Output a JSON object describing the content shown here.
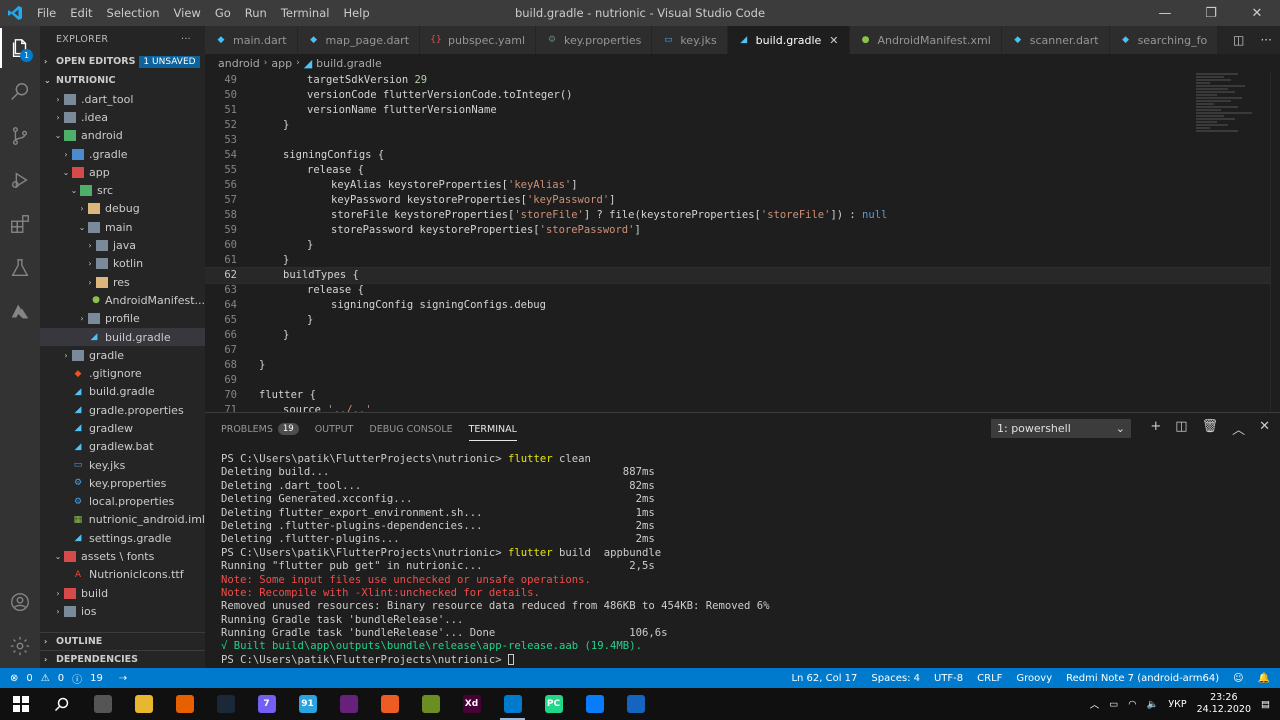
{
  "window": {
    "title": "build.gradle - nutrionic - Visual Studio Code",
    "menu": [
      "File",
      "Edit",
      "Selection",
      "View",
      "Go",
      "Run",
      "Terminal",
      "Help"
    ]
  },
  "activity": {
    "explorer_badge": "1"
  },
  "sidebar": {
    "header": "EXPLORER",
    "open_editors": "OPEN EDITORS",
    "unsaved": "1 UNSAVED",
    "project": "NUTRIONIC",
    "tree": [
      {
        "label": ".dart_tool",
        "depth": 1,
        "chev": "›",
        "icon": "folder"
      },
      {
        "label": ".idea",
        "depth": 1,
        "chev": "›",
        "icon": "folder"
      },
      {
        "label": "android",
        "depth": 1,
        "chev": "⌄",
        "icon": "folder-green"
      },
      {
        "label": ".gradle",
        "depth": 2,
        "chev": "›",
        "icon": "folder-blue"
      },
      {
        "label": "app",
        "depth": 2,
        "chev": "⌄",
        "icon": "folder-red"
      },
      {
        "label": "src",
        "depth": 3,
        "chev": "⌄",
        "icon": "folder-green"
      },
      {
        "label": "debug",
        "depth": 4,
        "chev": "›",
        "icon": "folder-yellow"
      },
      {
        "label": "main",
        "depth": 4,
        "chev": "⌄",
        "icon": "folder"
      },
      {
        "label": "java",
        "depth": 5,
        "chev": "›",
        "icon": "folder"
      },
      {
        "label": "kotlin",
        "depth": 5,
        "chev": "›",
        "icon": "folder"
      },
      {
        "label": "res",
        "depth": 5,
        "chev": "›",
        "icon": "folder-yellow"
      },
      {
        "label": "AndroidManifest...",
        "depth": 5,
        "chev": "",
        "icon": "android"
      },
      {
        "label": "profile",
        "depth": 4,
        "chev": "›",
        "icon": "folder"
      },
      {
        "label": "build.gradle",
        "depth": 4,
        "chev": "",
        "icon": "gradle",
        "selected": true
      },
      {
        "label": "gradle",
        "depth": 2,
        "chev": "›",
        "icon": "folder"
      },
      {
        "label": ".gitignore",
        "depth": 2,
        "chev": "",
        "icon": "git"
      },
      {
        "label": "build.gradle",
        "depth": 2,
        "chev": "",
        "icon": "gradle"
      },
      {
        "label": "gradle.properties",
        "depth": 2,
        "chev": "",
        "icon": "gradle"
      },
      {
        "label": "gradlew",
        "depth": 2,
        "chev": "",
        "icon": "gradle"
      },
      {
        "label": "gradlew.bat",
        "depth": 2,
        "chev": "",
        "icon": "gradle"
      },
      {
        "label": "key.jks",
        "depth": 2,
        "chev": "",
        "icon": "file"
      },
      {
        "label": "key.properties",
        "depth": 2,
        "chev": "",
        "icon": "gear"
      },
      {
        "label": "local.properties",
        "depth": 2,
        "chev": "",
        "icon": "gear"
      },
      {
        "label": "nutrionic_android.iml",
        "depth": 2,
        "chev": "",
        "icon": "iml"
      },
      {
        "label": "settings.gradle",
        "depth": 2,
        "chev": "",
        "icon": "gradle"
      },
      {
        "label": "assets \\ fonts",
        "depth": 1,
        "chev": "⌄",
        "icon": "folder-red"
      },
      {
        "label": "NutrionicIcons.ttf",
        "depth": 2,
        "chev": "",
        "icon": "font"
      },
      {
        "label": "build",
        "depth": 1,
        "chev": "›",
        "icon": "folder-red"
      },
      {
        "label": "ios",
        "depth": 1,
        "chev": "›",
        "icon": "folder"
      }
    ],
    "outline": "OUTLINE",
    "dependencies": "DEPENDENCIES"
  },
  "tabs": [
    {
      "label": "main.dart",
      "icon": "dart",
      "color": "#40c4ff"
    },
    {
      "label": "map_page.dart",
      "icon": "dart",
      "color": "#40c4ff"
    },
    {
      "label": "pubspec.yaml",
      "icon": "yaml",
      "color": "#f14c4c"
    },
    {
      "label": "key.properties",
      "icon": "gear",
      "color": "#6d8086"
    },
    {
      "label": "key.jks",
      "icon": "file",
      "color": "#42a5f5"
    },
    {
      "label": "build.gradle",
      "icon": "gradle",
      "color": "#4fc3f7",
      "active": true
    },
    {
      "label": "AndroidManifest.xml",
      "icon": "android",
      "color": "#8bc34a"
    },
    {
      "label": "scanner.dart",
      "icon": "dart",
      "color": "#40c4ff"
    },
    {
      "label": "searching_fo",
      "icon": "dart",
      "color": "#40c4ff"
    }
  ],
  "breadcrumb": [
    "android",
    "app",
    "build.gradle"
  ],
  "editor": {
    "lines": [
      {
        "n": "49",
        "indent": 2,
        "parts": [
          [
            "targetSdkVersion ",
            ""
          ],
          [
            "29",
            "num"
          ]
        ]
      },
      {
        "n": "50",
        "indent": 2,
        "parts": [
          [
            "versionCode flutterVersionCode.toInteger()",
            ""
          ]
        ]
      },
      {
        "n": "51",
        "indent": 2,
        "parts": [
          [
            "versionName flutterVersionName",
            ""
          ]
        ]
      },
      {
        "n": "52",
        "indent": 1,
        "parts": [
          [
            "}",
            ""
          ]
        ]
      },
      {
        "n": "53",
        "indent": 0,
        "parts": []
      },
      {
        "n": "54",
        "indent": 1,
        "parts": [
          [
            "signingConfigs {",
            ""
          ]
        ]
      },
      {
        "n": "55",
        "indent": 2,
        "parts": [
          [
            "release {",
            ""
          ]
        ]
      },
      {
        "n": "56",
        "indent": 3,
        "parts": [
          [
            "keyAlias keystoreProperties[",
            ""
          ],
          [
            "'keyAlias'",
            "str"
          ],
          [
            "]",
            ""
          ]
        ]
      },
      {
        "n": "57",
        "indent": 3,
        "parts": [
          [
            "keyPassword keystoreProperties[",
            ""
          ],
          [
            "'keyPassword'",
            "str"
          ],
          [
            "]",
            ""
          ]
        ]
      },
      {
        "n": "58",
        "indent": 3,
        "parts": [
          [
            "storeFile keystoreProperties[",
            ""
          ],
          [
            "'storeFile'",
            "str"
          ],
          [
            "] ? file(keystoreProperties[",
            ""
          ],
          [
            "'storeFile'",
            "str"
          ],
          [
            "]) : ",
            ""
          ],
          [
            "null",
            "kw"
          ]
        ]
      },
      {
        "n": "59",
        "indent": 3,
        "parts": [
          [
            "storePassword keystoreProperties[",
            ""
          ],
          [
            "'storePassword'",
            "str"
          ],
          [
            "]",
            ""
          ]
        ]
      },
      {
        "n": "60",
        "indent": 2,
        "parts": [
          [
            "}",
            ""
          ]
        ]
      },
      {
        "n": "61",
        "indent": 1,
        "parts": [
          [
            "}",
            ""
          ]
        ]
      },
      {
        "n": "62",
        "indent": 1,
        "parts": [
          [
            "buildTypes {",
            ""
          ]
        ],
        "cur": true
      },
      {
        "n": "63",
        "indent": 2,
        "parts": [
          [
            "release {",
            ""
          ]
        ]
      },
      {
        "n": "64",
        "indent": 3,
        "parts": [
          [
            "signingConfig signingConfigs.debug",
            ""
          ]
        ]
      },
      {
        "n": "65",
        "indent": 2,
        "parts": [
          [
            "}",
            ""
          ]
        ]
      },
      {
        "n": "66",
        "indent": 1,
        "parts": [
          [
            "}",
            ""
          ]
        ]
      },
      {
        "n": "67",
        "indent": 0,
        "parts": []
      },
      {
        "n": "68",
        "indent": 0,
        "parts": [
          [
            "}",
            ""
          ]
        ]
      },
      {
        "n": "69",
        "indent": 0,
        "parts": []
      },
      {
        "n": "70",
        "indent": 0,
        "parts": [
          [
            "flutter {",
            ""
          ]
        ]
      },
      {
        "n": "71",
        "indent": 1,
        "parts": [
          [
            "source ",
            ""
          ],
          [
            "'../..'",
            "str"
          ]
        ]
      }
    ]
  },
  "panel": {
    "tabs": [
      "PROBLEMS",
      "OUTPUT",
      "DEBUG CONSOLE",
      "TERMINAL"
    ],
    "problems_count": "19",
    "active_tab": "TERMINAL",
    "terminal_select": "1: powershell",
    "terminal": [
      {
        "parts": [
          [
            "PS C:\\Users\\patik\\FlutterProjects\\nutrionic> ",
            ""
          ],
          [
            "flutter",
            "t-cmd"
          ],
          [
            " clean",
            ""
          ]
        ]
      },
      {
        "parts": [
          [
            "Deleting build...                                              887ms",
            ""
          ]
        ]
      },
      {
        "parts": [
          [
            "Deleting .dart_tool...                                          82ms",
            ""
          ]
        ]
      },
      {
        "parts": [
          [
            "Deleting Generated.xcconfig...                                   2ms",
            ""
          ]
        ]
      },
      {
        "parts": [
          [
            "Deleting flutter_export_environment.sh...                        1ms",
            ""
          ]
        ]
      },
      {
        "parts": [
          [
            "Deleting .flutter-plugins-dependencies...                        2ms",
            ""
          ]
        ]
      },
      {
        "parts": [
          [
            "Deleting .flutter-plugins...                                     2ms",
            ""
          ]
        ]
      },
      {
        "parts": [
          [
            "PS C:\\Users\\patik\\FlutterProjects\\nutrionic> ",
            ""
          ],
          [
            "flutter",
            "t-cmd"
          ],
          [
            " build  appbundle",
            ""
          ]
        ]
      },
      {
        "parts": [
          [
            "Running \"flutter pub get\" in nutrionic...                       2,5s",
            ""
          ]
        ]
      },
      {
        "parts": [
          [
            "Note: Some input files use unchecked or unsafe operations.",
            "t-red"
          ]
        ]
      },
      {
        "parts": [
          [
            "Note: Recompile with -Xlint:unchecked for details.",
            "t-red"
          ]
        ]
      },
      {
        "parts": [
          [
            "Removed unused resources: Binary resource data reduced from 486KB to 454KB: Removed 6%",
            ""
          ]
        ]
      },
      {
        "parts": [
          [
            "Running Gradle task 'bundleRelease'...",
            ""
          ]
        ]
      },
      {
        "parts": [
          [
            "Running Gradle task 'bundleRelease'... Done                     106,6s",
            ""
          ]
        ]
      },
      {
        "parts": [
          [
            "√ Built build\\app\\outputs\\bundle\\release\\app-release.aab (19.4MB).",
            "t-green"
          ]
        ]
      },
      {
        "parts": [
          [
            "PS C:\\Users\\patik\\FlutterProjects\\nutrionic> ",
            ""
          ]
        ],
        "cursor": true
      }
    ]
  },
  "statusbar": {
    "errors": "0",
    "warnings": "0",
    "info": "19",
    "position": "Ln 62, Col 17",
    "spaces": "Spaces: 4",
    "encoding": "UTF-8",
    "eol": "CRLF",
    "language": "Groovy",
    "device": "Redmi Note 7 (android-arm64)"
  },
  "taskbar": {
    "apps": [
      {
        "name": "windows-start",
        "color": "",
        "label": ""
      },
      {
        "name": "search",
        "color": "",
        "label": ""
      },
      {
        "name": "task-view",
        "color": "#555555",
        "label": ""
      },
      {
        "name": "file-explorer",
        "color": "#e8b730",
        "label": ""
      },
      {
        "name": "firefox",
        "color": "#e66000",
        "label": ""
      },
      {
        "name": "steam",
        "color": "#1b2838",
        "label": ""
      },
      {
        "name": "viber",
        "color": "#7360f2",
        "label": "7"
      },
      {
        "name": "telegram",
        "color": "#2aa3e0",
        "label": "91"
      },
      {
        "name": "visual-studio",
        "color": "#68217a",
        "label": ""
      },
      {
        "name": "postman",
        "color": "#ef5b25",
        "label": ""
      },
      {
        "name": "android-app",
        "color": "#6b8e23",
        "label": ""
      },
      {
        "name": "adobe-xd",
        "color": "#470137",
        "label": "Xd"
      },
      {
        "name": "vscode",
        "color": "#007acc",
        "label": "",
        "running": true
      },
      {
        "name": "pycharm",
        "color": "#21d789",
        "label": "PC"
      },
      {
        "name": "jetbrains",
        "color": "#087cfa",
        "label": ""
      },
      {
        "name": "app-blue",
        "color": "#1565c0",
        "label": ""
      }
    ],
    "lang": "УКР",
    "time": "23:26",
    "date": "24.12.2020"
  }
}
